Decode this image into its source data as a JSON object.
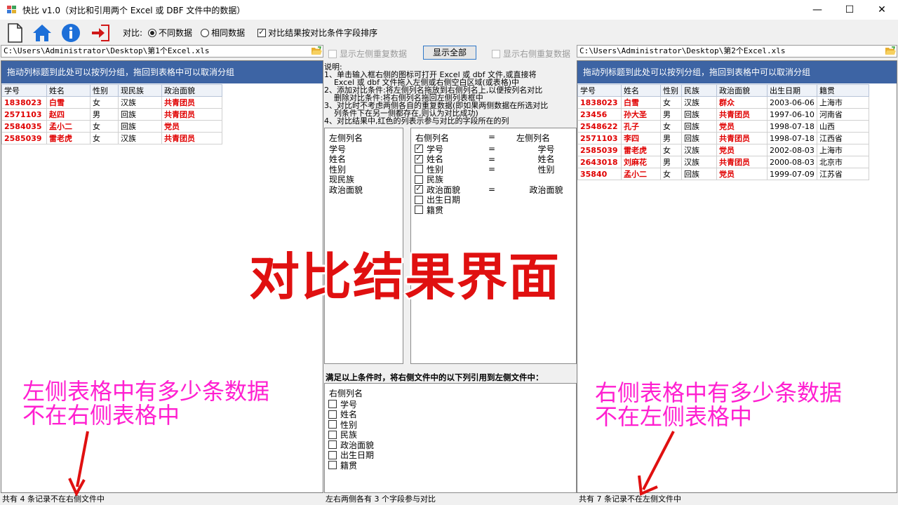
{
  "window": {
    "title": "快比 v1.0（对比和引用两个 Excel 或 DBF 文件中的数据）",
    "minimize": "—",
    "maximize": "☐",
    "close": "✕"
  },
  "toolbar": {
    "icons": [
      "new-file-icon",
      "home-icon",
      "info-icon",
      "exit-icon"
    ],
    "compare_label": "对比:",
    "radio_different": "不同数据",
    "radio_same": "相同数据",
    "sort_checkbox": "对比结果按对比条件字段排序",
    "colors": {
      "home": "#1d6fd8",
      "info": "#1d6fd8",
      "exit": "#d01818"
    }
  },
  "left": {
    "path": "C:\\Users\\Administrator\\Desktop\\第1个Excel.xls",
    "group_hint": "拖动列标题到此处可以按列分组，拖回到表格中可以取消分组",
    "columns": [
      "学号",
      "姓名",
      "性别",
      "现民族",
      "政治面貌"
    ],
    "rows": [
      [
        "1838023",
        "白雪",
        "女",
        "汉族",
        "共青团员"
      ],
      [
        "2571103",
        "赵四",
        "男",
        "回族",
        "共青团员"
      ],
      [
        "2584035",
        "孟小二",
        "女",
        "回族",
        "党员"
      ],
      [
        "2585039",
        "雷老虎",
        "女",
        "汉族",
        "共青团员"
      ]
    ],
    "status": "共有 4 条记录不在右侧文件中"
  },
  "right": {
    "path": "C:\\Users\\Administrator\\Desktop\\第2个Excel.xls",
    "group_hint": "拖动列标题到此处可以按列分组，拖回到表格中可以取消分组",
    "columns": [
      "学号",
      "姓名",
      "性别",
      "民族",
      "政治面貌",
      "出生日期",
      "籍贯"
    ],
    "rows": [
      [
        "1838023",
        "白雪",
        "女",
        "汉族",
        "群众",
        "2003-06-06",
        "上海市"
      ],
      [
        "23456",
        "孙大圣",
        "男",
        "回族",
        "共青团员",
        "1997-06-10",
        "河南省"
      ],
      [
        "2548622",
        "孔子",
        "女",
        "回族",
        "党员",
        "1998-07-18",
        "山西"
      ],
      [
        "2571103",
        "李四",
        "男",
        "回族",
        "共青团员",
        "1998-07-18",
        "江西省"
      ],
      [
        "2585039",
        "雷老虎",
        "女",
        "汉族",
        "党员",
        "2002-08-03",
        "上海市"
      ],
      [
        "2643018",
        "刘麻花",
        "男",
        "汉族",
        "共青团员",
        "2000-08-03",
        "北京市"
      ],
      [
        "35840",
        "孟小二",
        "女",
        "回族",
        "党员",
        "1999-07-09",
        "江苏省"
      ]
    ],
    "status": "共有 7 条记录不在左侧文件中"
  },
  "middle": {
    "show_left_dup": "显示左侧重复数据",
    "show_all": "显示全部",
    "show_right_dup": "显示右侧重复数据",
    "help_lines": [
      "说明:",
      "1、单击输入框右侧的图标可打开 Excel 或 dbf 文件,或直接将",
      "    Excel 或 dbf 文件拖入左侧或右侧空白区域(或表格)中",
      "2、添加对比条件:将左侧列名拖放到右侧列名上,以便按列名对比",
      "    删除对比条件:将右侧列名拖回左侧列表框中",
      "3、对比时不考虑两侧各自的重复数据(即如果两侧数据在所选对比",
      "    列条件下在另一侧都存在,则认为对比成功)",
      "4、对比结果中,红色的列表示参与对比的字段所在的列"
    ],
    "left_list_header": "左侧列名",
    "left_list": [
      "学号",
      "姓名",
      "性别",
      "现民族",
      "政治面貌"
    ],
    "right_list_header": "右侧列名",
    "eq": "=",
    "right_list_header2": "左侧列名",
    "right_list": [
      {
        "name": "学号",
        "checked": true,
        "eq": "=",
        "match": "学号"
      },
      {
        "name": "姓名",
        "checked": true,
        "eq": "=",
        "match": "姓名"
      },
      {
        "name": "性别",
        "checked": false,
        "eq": "=",
        "match": "性别"
      },
      {
        "name": "民族",
        "checked": false,
        "eq": "",
        "match": ""
      },
      {
        "name": "政治面貌",
        "checked": true,
        "eq": "=",
        "match": "政治面貌"
      },
      {
        "name": "出生日期",
        "checked": false,
        "eq": "",
        "match": ""
      },
      {
        "name": "籍贯",
        "checked": false,
        "eq": "",
        "match": ""
      }
    ],
    "ref_label": "满足以上条件时，将右侧文件中的以下列引用到左侧文件中：",
    "ref_header": "右侧列名",
    "ref_list": [
      "学号",
      "姓名",
      "性别",
      "民族",
      "政治面貌",
      "出生日期",
      "籍贯"
    ],
    "status": "左右两侧各有 3 个字段参与对比"
  },
  "overlay": {
    "big": "对比结果界面",
    "left_note_1": "左侧表格中有多少条数据",
    "left_note_2": "不在右侧表格中",
    "right_note_1": "右侧表格中有多少条数据",
    "right_note_2": "不在左侧表格中",
    "colors": {
      "big": "#e01010",
      "note": "#ff1fd0",
      "arrow": "#e01010"
    }
  }
}
